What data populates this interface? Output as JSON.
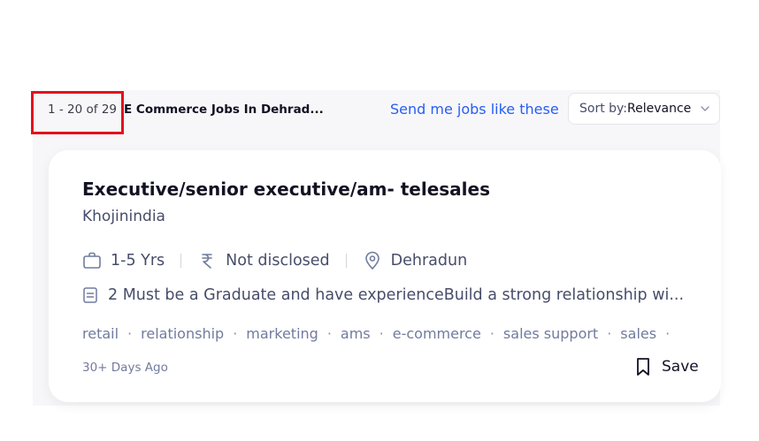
{
  "results": {
    "count_text": "1 - 20 of 29",
    "title": "E Commerce Jobs In Dehrad..."
  },
  "actions": {
    "send_jobs_label": "Send me jobs like these",
    "sort_prefix": "Sort by: ",
    "sort_value": "Relevance"
  },
  "job": {
    "title": "Executive/senior executive/am- telesales",
    "company": "Khojinindia",
    "experience": "1-5 Yrs",
    "salary": "Not disclosed",
    "location": "Dehradun",
    "description": "2 Must be a Graduate and have experienceBuild a strong relationship wi...",
    "tags": [
      "retail",
      "relationship",
      "marketing",
      "ams",
      "e-commerce",
      "sales support",
      "sales"
    ],
    "posted": "30+ Days Ago",
    "save_label": "Save"
  },
  "colors": {
    "link": "#275df5",
    "highlight": "#e2121d",
    "text_primary": "#121224",
    "text_secondary": "#474d6a"
  }
}
